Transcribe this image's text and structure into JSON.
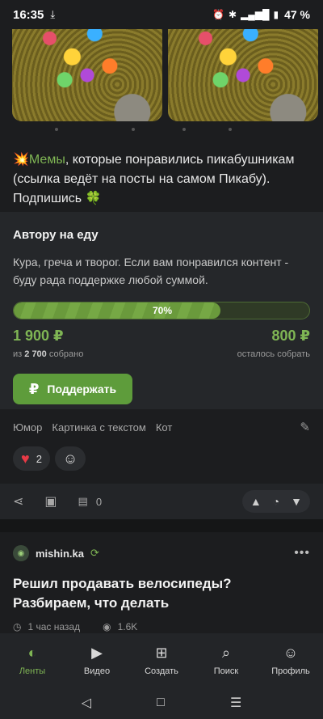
{
  "status_bar": {
    "time": "16:35",
    "battery": "47 %"
  },
  "post": {
    "text_emoji": "💥",
    "text_link": "Мемы",
    "text_rest": ", которые понравились пикабушникам (ссылка ведёт на посты на самом Пикабу). Подпишись",
    "text_clover": "🍀"
  },
  "donation": {
    "title": "Автору на еду",
    "description": "Кура, греча и творог. Если вам понравился контент - буду рада поддержке любой суммой.",
    "progress": 0.7,
    "progress_label": "70%",
    "collected": "1 900 ₽",
    "remaining": "800 ₽",
    "goal_prefix": "из",
    "goal_amount": "2 700",
    "goal_suffix": "собрано",
    "remaining_label": "осталось собрать",
    "button_icon": "₽",
    "button_label": "Поддержать"
  },
  "tags": [
    "Юмор",
    "Картинка с текстом",
    "Кот"
  ],
  "reactions": {
    "likes": "2"
  },
  "actions": {
    "comments_count": "0"
  },
  "next_post": {
    "author": "mishin.ka",
    "title_line1": "Решил продавать велосипеды?",
    "title_line2": "Разбираем, что делать",
    "time": "1 час назад",
    "views": "1.6K"
  },
  "bottom_nav": {
    "items": [
      {
        "label": "Ленты",
        "icon": "feeds-icon"
      },
      {
        "label": "Видео",
        "icon": "video-icon"
      },
      {
        "label": "Создать",
        "icon": "create-icon"
      },
      {
        "label": "Поиск",
        "icon": "search-icon"
      },
      {
        "label": "Профиль",
        "icon": "profile-icon"
      }
    ]
  },
  "colors": {
    "accent": "#7fb554",
    "background": "#1c1d1f",
    "card": "#25272a",
    "like": "#e83a46"
  }
}
